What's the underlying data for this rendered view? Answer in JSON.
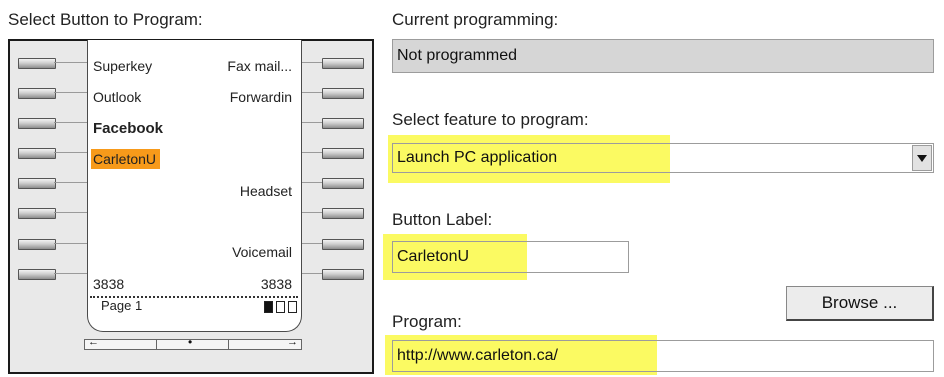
{
  "left": {
    "heading": "Select Button to Program:"
  },
  "phone": {
    "softkeys_left": [
      "Superkey",
      "Outlook",
      "Facebook",
      "CarletonU",
      "",
      "",
      "",
      "3838"
    ],
    "softkeys_right": [
      "Fax mail...",
      "Forwardin",
      "",
      "",
      "Headset",
      "",
      "Voicemail",
      "3838"
    ],
    "selected_key": "CarletonU",
    "page_label": "Page 1",
    "nav_left_glyph": "←",
    "nav_mid_glyph": "•",
    "nav_right_glyph": "→"
  },
  "right": {
    "current_programming_label": "Current programming:",
    "current_programming_value": "Not programmed",
    "feature_label": "Select feature to program:",
    "feature_value": "Launch PC application",
    "button_label_label": "Button Label:",
    "button_label_value": "CarletonU",
    "browse_label": "Browse ...",
    "program_label": "Program:",
    "program_value": "http://www.carleton.ca/",
    "highlight_color": "#fbfa62",
    "selected_color": "#f79a1a"
  }
}
